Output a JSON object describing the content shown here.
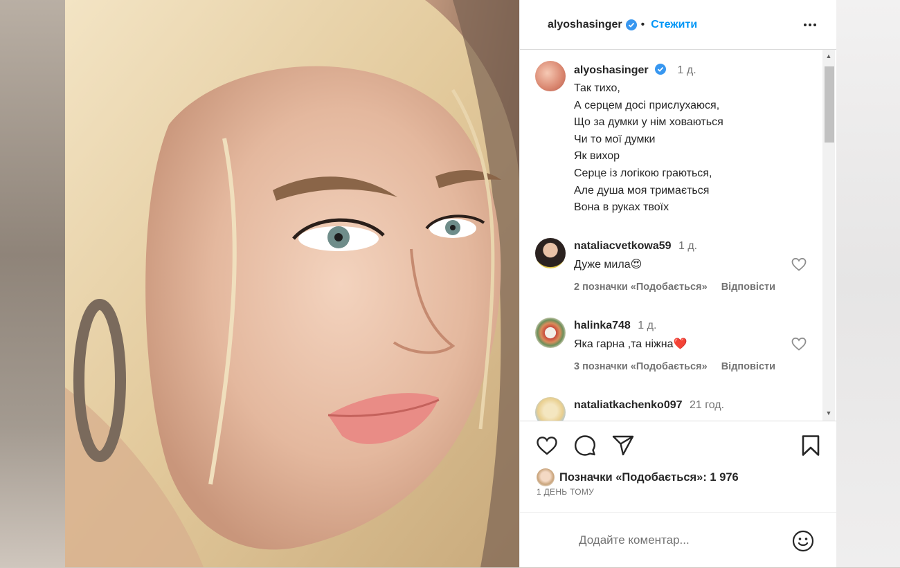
{
  "post": {
    "username": "alyoshasinger",
    "follow_label": "Стежити",
    "caption": {
      "username": "alyoshasinger",
      "time": "1 д.",
      "lines": [
        "Так тихо,",
        "А серцем досі прислухаюся,",
        "Що за думки у нім ховаються",
        "Чи то мої думки",
        "Як вихор",
        "Серце із логікою граються,",
        "Але душа моя тримається",
        "Вона в руках твоїх"
      ]
    },
    "comments": [
      {
        "username": "nataliacvetkowa59",
        "time": "1 д.",
        "text": "Дуже мила😍",
        "likes": "2 позначки «Подобається»",
        "reply": "Відповісти"
      },
      {
        "username": "halinka748",
        "time": "1 д.",
        "text": "Яка гарна ,та ніжна❤️",
        "likes": "3 позначки «Подобається»",
        "reply": "Відповісти"
      },
      {
        "username": "nataliatkachenko097",
        "time": "21 год.",
        "text": "",
        "likes": "",
        "reply": ""
      }
    ],
    "likes_text": "Позначки «Подобається»: 1 976",
    "date_text": "1 ДЕНЬ ТОМУ",
    "comment_placeholder": "Додайте коментар...",
    "icons": {
      "verified": "verified-badge-icon",
      "more": "more-options-icon",
      "like": "heart-icon",
      "comment": "comment-icon",
      "share": "paper-plane-icon",
      "save": "bookmark-icon",
      "emoji": "smiley-icon"
    },
    "colors": {
      "accent": "#0095f6",
      "verified": "#3897f0",
      "muted": "#737373"
    }
  }
}
